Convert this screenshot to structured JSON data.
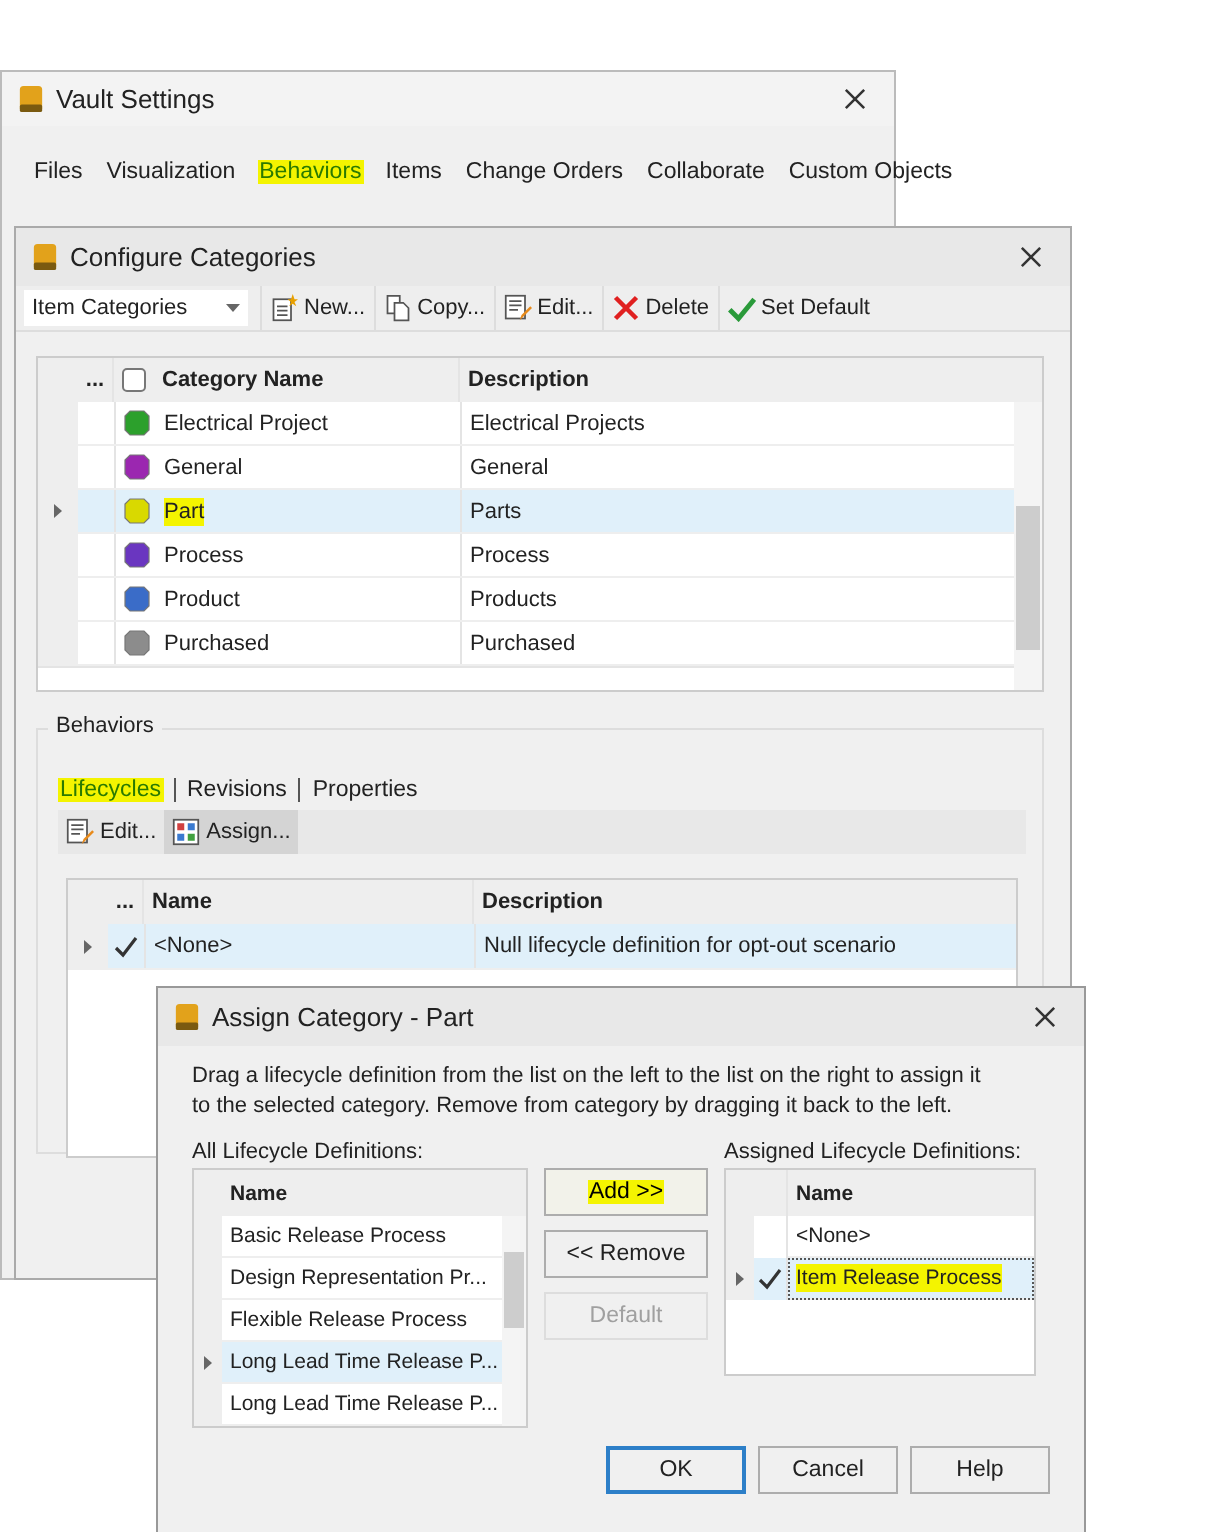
{
  "vault_settings": {
    "title": "Vault Settings",
    "tabs": [
      {
        "label": "Files",
        "selected": false,
        "highlighted": false
      },
      {
        "label": "Visualization",
        "selected": false,
        "highlighted": false
      },
      {
        "label": "Behaviors",
        "selected": true,
        "highlighted": true
      },
      {
        "label": "Items",
        "selected": false,
        "highlighted": false
      },
      {
        "label": "Change Orders",
        "selected": false,
        "highlighted": false
      },
      {
        "label": "Collaborate",
        "selected": false,
        "highlighted": false
      },
      {
        "label": "Custom Objects",
        "selected": false,
        "highlighted": false
      }
    ]
  },
  "configure_categories": {
    "title": "Configure Categories",
    "dropdown": {
      "value": "Item Categories"
    },
    "toolbar": [
      {
        "label": "New...",
        "kind": "new"
      },
      {
        "label": "Copy...",
        "kind": "copy"
      },
      {
        "label": "Edit...",
        "kind": "edit"
      },
      {
        "label": "Delete",
        "kind": "delete"
      },
      {
        "label": "Set Default",
        "kind": "check"
      }
    ],
    "table": {
      "columns": [
        "...",
        "Category Name",
        "Description"
      ],
      "header_checked": false,
      "rows": [
        {
          "name": "Electrical Project",
          "description": "Electrical Projects",
          "color": "#2ca02c",
          "selected": false,
          "highlighted": false
        },
        {
          "name": "General",
          "description": "General",
          "color": "#9b27b0",
          "selected": false,
          "highlighted": false
        },
        {
          "name": "Part",
          "description": "Parts",
          "color": "#d9d900",
          "selected": true,
          "highlighted": true
        },
        {
          "name": "Process",
          "description": "Process",
          "color": "#6a36c0",
          "selected": false,
          "highlighted": false
        },
        {
          "name": "Product",
          "description": "Products",
          "color": "#3a6cc8",
          "selected": false,
          "highlighted": false
        },
        {
          "name": "Purchased",
          "description": "Purchased",
          "color": "#8c8c8c",
          "selected": false,
          "highlighted": false
        }
      ]
    },
    "behaviors": {
      "title": "Behaviors",
      "tabs": [
        {
          "label": "Lifecycles",
          "selected": true,
          "highlighted": true
        },
        {
          "label": "Revisions",
          "selected": false,
          "highlighted": false
        },
        {
          "label": "Properties",
          "selected": false,
          "highlighted": false
        }
      ],
      "toolbar": [
        {
          "label": "Edit...",
          "kind": "edit",
          "pressed": false
        },
        {
          "label": "Assign...",
          "kind": "assign",
          "pressed": true
        }
      ],
      "table": {
        "columns": [
          "...",
          "Name",
          "Description"
        ],
        "rows": [
          {
            "name": "<None>",
            "description": "Null lifecycle definition for opt-out scenario",
            "checked": true,
            "selected": true
          }
        ]
      }
    }
  },
  "assign_category": {
    "title": "Assign Category - Part",
    "instructions": "Drag a lifecycle definition from the list on the left to the list on the right to assign it to the selected category. Remove from category by dragging it back to the left.",
    "all_label": "All Lifecycle Definitions:",
    "all_table": {
      "column": "Name",
      "rows": [
        {
          "name": "Basic Release Process",
          "selected": false
        },
        {
          "name": "Design Representation Pr...",
          "selected": false
        },
        {
          "name": "Flexible Release Process",
          "selected": false
        },
        {
          "name": "Long Lead Time Release P...",
          "selected": true
        },
        {
          "name": "Long Lead Time Release P...",
          "selected": false
        }
      ]
    },
    "buttons": [
      {
        "label": "Add >>",
        "disabled": false,
        "highlighted": true
      },
      {
        "label": "<< Remove",
        "disabled": false,
        "highlighted": false
      },
      {
        "label": "Default",
        "disabled": true,
        "highlighted": false
      }
    ],
    "assigned_label": "Assigned Lifecycle Definitions:",
    "assigned_table": {
      "column": "Name",
      "rows": [
        {
          "name": "<None>",
          "checked": false,
          "selected": false,
          "highlighted": false
        },
        {
          "name": "Item Release Process",
          "checked": true,
          "selected": true,
          "highlighted": true
        }
      ]
    },
    "footer": [
      {
        "label": "OK",
        "default": true
      },
      {
        "label": "Cancel",
        "default": false
      },
      {
        "label": "Help",
        "default": false
      }
    ]
  }
}
